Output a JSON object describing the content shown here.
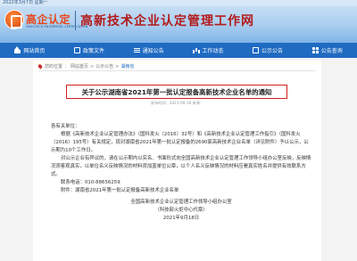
{
  "header": {
    "date": "2022年3月7日 星期一",
    "logo_name": "高企认定",
    "logo_sub": "HIGH-TECH ENTERPRISE CERTIFICATION",
    "site_title": "高新技术企业认定管理工作网"
  },
  "nav": [
    {
      "label": "网站首页",
      "icon": "home-icon"
    },
    {
      "label": "政策文件",
      "icon": "document-icon"
    },
    {
      "label": "通知公告",
      "icon": "list-icon"
    },
    {
      "label": "工作动态",
      "icon": "chart-icon"
    },
    {
      "label": "公示公告",
      "icon": "box-icon"
    },
    {
      "label": "公告查询",
      "icon": "grid-icon"
    }
  ],
  "breadcrumb": [
    "您的位置",
    "网站首页",
    "公示公告",
    "湖南省"
  ],
  "article": {
    "title": "关于公示湖南省2021年第一批认定报备高新技术企业名单的通知",
    "meta": "发布时间：2021-09-18  来源：",
    "greeting": "各有关单位：",
    "para1": "根据《高新技术企业认定管理办法》（国科发火〔2016〕32号）和《高新技术企业认定管理工作指引》（国科发火〔2016〕195号）有关规定，现对湖南省2021年第一批认定报备的2690家高新技术企业名单（详见附件）予以公示，公示期为10个工作日。",
    "para2": "对公示企业有异议的，请在公示期内以实名、书面形式向全国高新技术企业认定管理工作领导小组办公室反映，反映情况须客观真实，以单位名义反映情况的材料须加盖单位公章，以个人名义反映情况的材料应署真实姓名并提供有效联系方式。",
    "phone": "联系电话：010-88656259",
    "attachment": "附件：湖南省2021年第一批认定报备高新技术企业名单",
    "sign1": "全国高新技术企业认定管理工作领导小组办公室",
    "sign2": "（科技部火炬中心代章）",
    "sign_date": "2021年9月18日"
  }
}
